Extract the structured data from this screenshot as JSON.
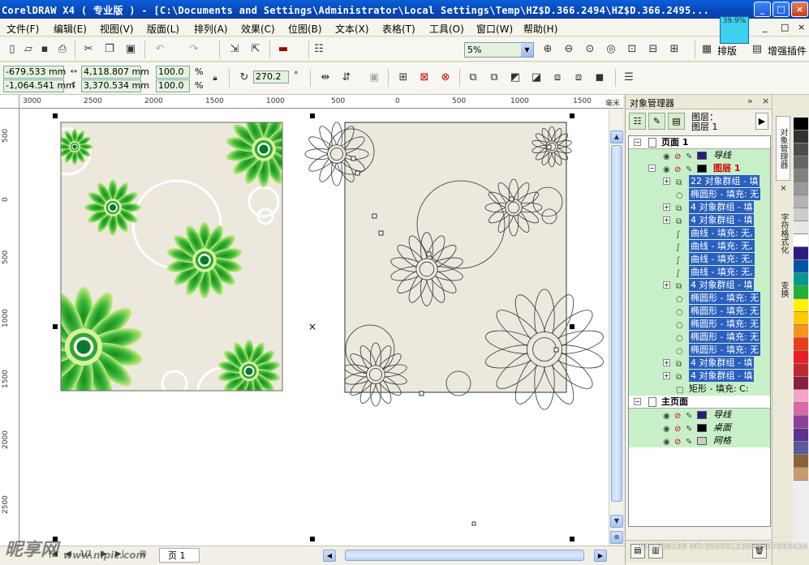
{
  "window": {
    "title": "CorelDRAW X4 ( 专业版 ) - [C:\\Documents and Settings\\Administrator\\Local Settings\\Temp\\HZ$D.366.2494\\HZ$D.366.2495...",
    "zoom_badge": "39.9%",
    "btn_min": "_",
    "btn_max": "□",
    "btn_close": "×"
  },
  "menu": {
    "items": [
      "文件(F)",
      "编辑(E)",
      "视图(V)",
      "版面(L)",
      "排列(A)",
      "效果(C)",
      "位图(B)",
      "文本(X)",
      "表格(T)",
      "工具(O)",
      "窗口(W)",
      "帮助(H)"
    ],
    "mdi_min": "_",
    "mdi_max": "□",
    "mdi_close": "×"
  },
  "toolbar": {
    "zoom_level": "5%",
    "layout_label": "排版",
    "plugin_label": "增强插件"
  },
  "property_bar": {
    "x": "-679.533 mm",
    "y": "-1,064.541 mm",
    "width": "4,118.807 mm",
    "height": "3,370.534 mm",
    "scale_x": "100.0",
    "scale_y": "100.0",
    "percent": "%",
    "rotation": "270.2",
    "degree": "°"
  },
  "ruler": {
    "h_ticks": [
      "3000",
      "2500",
      "2000",
      "1500",
      "1000",
      "500",
      "0",
      "500",
      "1000",
      "1500"
    ],
    "h_unit": "毫米",
    "v_ticks": [
      "500",
      "0",
      "500",
      "1000",
      "1500",
      "2000",
      "2500"
    ]
  },
  "bottom": {
    "page_tab": "页 1",
    "page_counter": "1/1",
    "watermark": "昵享网",
    "watermark_url": "www.nipic.com",
    "watermark_id": "ID:2508159 NO:20100123094357055434"
  },
  "docker": {
    "title": "对象管理器",
    "layer_label": "图层：",
    "layer_name": "图层 1",
    "rows": [
      {
        "text": "页面 1",
        "kind": "page"
      },
      {
        "text": "导线",
        "kind": "layer"
      },
      {
        "text": "图层 1",
        "kind": "layer-active"
      },
      {
        "text": "22 对象群组 - 填",
        "kind": "group"
      },
      {
        "text": "椭圆形 - 填充: 无",
        "kind": "ellipse"
      },
      {
        "text": "4 对象群组 - 填",
        "kind": "group"
      },
      {
        "text": "4 对象群组 - 填",
        "kind": "group"
      },
      {
        "text": "曲线 - 填充: 无,",
        "kind": "curve"
      },
      {
        "text": "曲线 - 填充: 无,",
        "kind": "curve"
      },
      {
        "text": "曲线 - 填充: 无,",
        "kind": "curve"
      },
      {
        "text": "曲线 - 填充: 无,",
        "kind": "curve"
      },
      {
        "text": "4 对象群组 - 填",
        "kind": "group"
      },
      {
        "text": "椭圆形 - 填充: 无",
        "kind": "ellipse"
      },
      {
        "text": "椭圆形 - 填充: 无",
        "kind": "ellipse"
      },
      {
        "text": "椭圆形 - 填充: 无",
        "kind": "ellipse"
      },
      {
        "text": "椭圆形 - 填充: 无",
        "kind": "ellipse"
      },
      {
        "text": "椭圆形 - 填充: 无",
        "kind": "ellipse"
      },
      {
        "text": "4 对象群组 - 填",
        "kind": "group"
      },
      {
        "text": "4 对象群组 - 填",
        "kind": "group"
      },
      {
        "text": "矩形 - 填充: C:",
        "kind": "rect"
      },
      {
        "text": "主页面",
        "kind": "page"
      },
      {
        "text": "导线",
        "kind": "layer"
      },
      {
        "text": "桌面",
        "kind": "layer"
      },
      {
        "text": "网格",
        "kind": "layer"
      }
    ]
  },
  "side_tabs": [
    "对象管理器",
    "字符格式化",
    "变换"
  ],
  "palette": [
    "#000000",
    "#333333",
    "#4d4d4d",
    "#666666",
    "#808080",
    "#999999",
    "#b3b3b3",
    "#cccccc",
    "#e6e6e6",
    "#ffffff",
    "#2e1a80",
    "#0055a5",
    "#009b8c",
    "#1fb03c",
    "#fff200",
    "#ffcc00",
    "#f7941d",
    "#e8401c",
    "#ed1c24",
    "#c0282e",
    "#8b1e3f",
    "#f5a3c7",
    "#d96aa7",
    "#8f3f97",
    "#5c3292",
    "#5a5a9a",
    "#8c6239",
    "#c69c6d"
  ],
  "colors": {
    "artwork_bg": "#ece8de",
    "flower_green": "#2ea82e",
    "flower_light": "#a8e060",
    "tree_highlight": "#c8f0c8"
  }
}
